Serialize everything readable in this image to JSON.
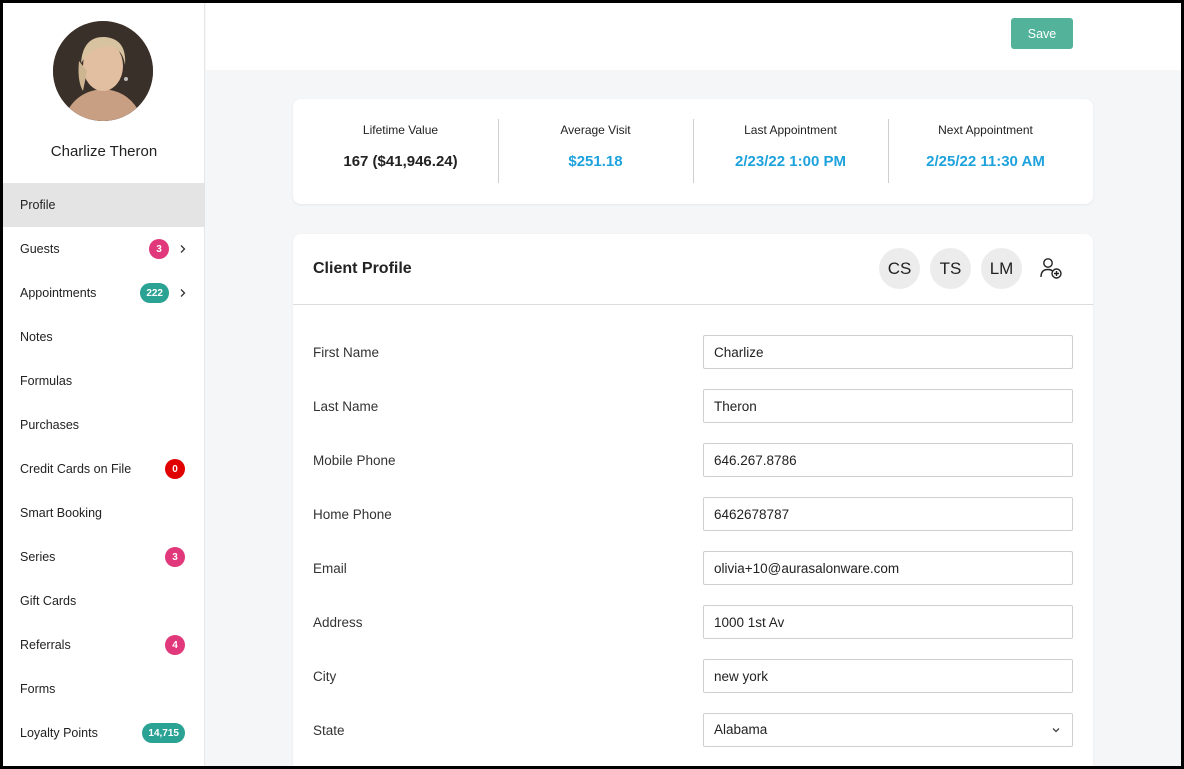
{
  "client": {
    "name": "Charlize Theron"
  },
  "sidebar": {
    "items": [
      {
        "label": "Profile",
        "active": true
      },
      {
        "label": "Guests",
        "badge": "3",
        "badge_color": "#e0387a",
        "chevron": true
      },
      {
        "label": "Appointments",
        "badge": "222",
        "badge_color": "#2aa394",
        "chevron": true
      },
      {
        "label": "Notes"
      },
      {
        "label": "Formulas"
      },
      {
        "label": "Purchases"
      },
      {
        "label": "Credit Cards on File",
        "badge": "0",
        "badge_color": "#e00000"
      },
      {
        "label": "Smart Booking"
      },
      {
        "label": "Series",
        "badge": "3",
        "badge_color": "#e0387a"
      },
      {
        "label": "Gift Cards"
      },
      {
        "label": "Referrals",
        "badge": "4",
        "badge_color": "#e0387a"
      },
      {
        "label": "Forms"
      },
      {
        "label": "Loyalty Points",
        "badge": "14,715",
        "badge_color": "#2aa394"
      }
    ]
  },
  "toolbar": {
    "save_label": "Save"
  },
  "stats": [
    {
      "label": "Lifetime Value",
      "value": "167 ($41,946.24)"
    },
    {
      "label": "Average Visit",
      "value": "$251.18"
    },
    {
      "label": "Last Appointment",
      "value": "2/23/22 1:00 PM"
    },
    {
      "label": "Next Appointment",
      "value": "2/25/22 11:30 AM"
    }
  ],
  "profile": {
    "title": "Client Profile",
    "staff_initials": [
      "CS",
      "TS",
      "LM"
    ],
    "fields": [
      {
        "label": "First Name",
        "value": "Charlize"
      },
      {
        "label": "Last Name",
        "value": "Theron"
      },
      {
        "label": "Mobile Phone",
        "value": "646.267.8786"
      },
      {
        "label": "Home Phone",
        "value": "6462678787"
      },
      {
        "label": "Email",
        "value": "olivia+10@aurasalonware.com"
      },
      {
        "label": "Address",
        "value": "1000 1st Av"
      },
      {
        "label": "City",
        "value": "new york"
      },
      {
        "label": "State",
        "value": "Alabama"
      }
    ]
  },
  "colors": {
    "accent": "#52b39a",
    "link_blue": "#1ea2dc"
  }
}
